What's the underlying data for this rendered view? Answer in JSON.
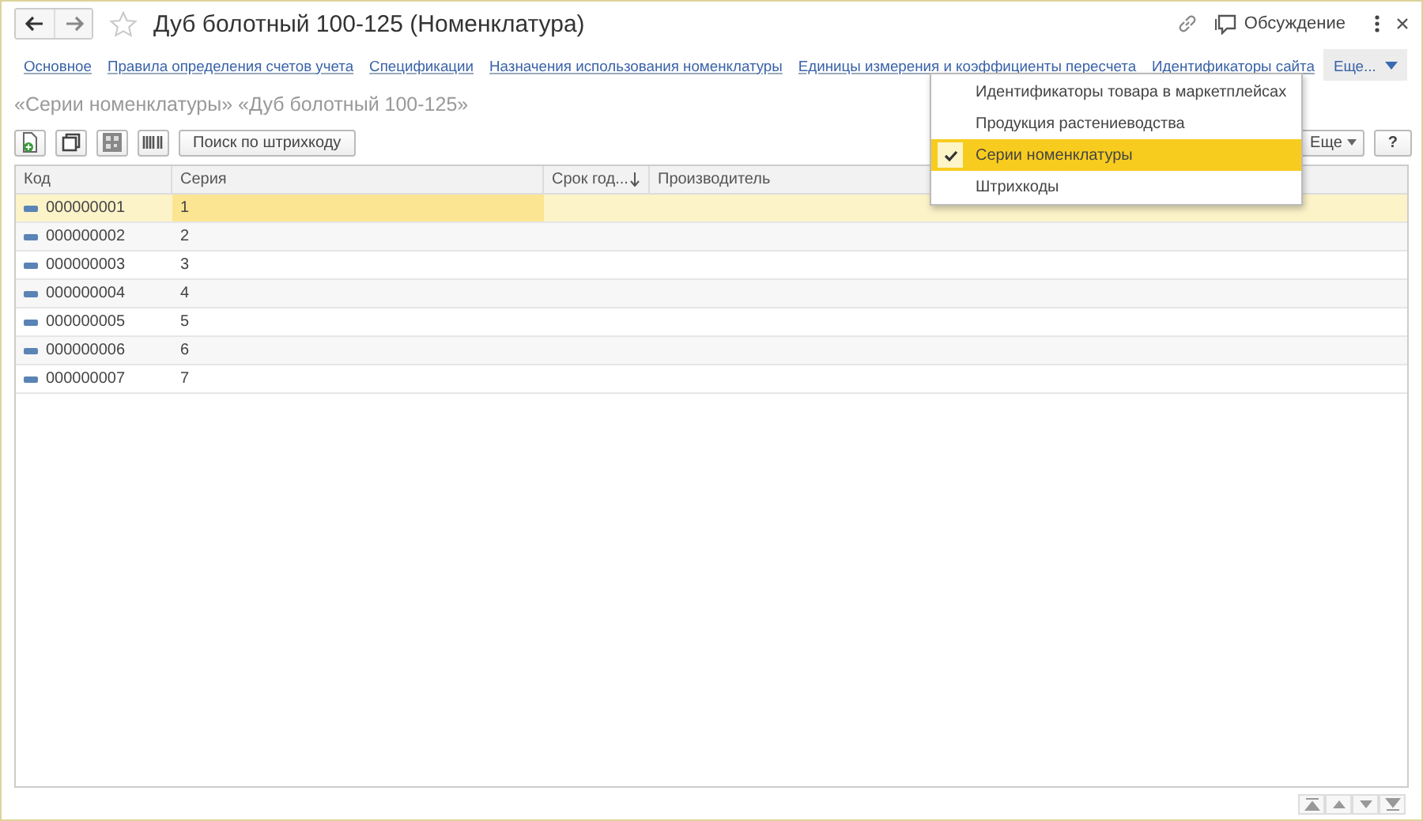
{
  "window": {
    "title": "Дуб болотный 100-125 (Номенклатура)",
    "discussion": "Обсуждение"
  },
  "tabs": [
    {
      "label": "Основное"
    },
    {
      "label": "Правила определения счетов учета"
    },
    {
      "label": "Спецификации"
    },
    {
      "label": "Назначения использования номенклатуры"
    },
    {
      "label": "Единицы измерения и коэффициенты пересчета"
    },
    {
      "label": "Идентификаторы сайта"
    }
  ],
  "more_tab": {
    "label": "Еще...",
    "expanded": true
  },
  "more_menu": [
    {
      "label": "Идентификаторы товара в маркетплейсах",
      "checked": false,
      "selected": false
    },
    {
      "label": "Продукция растениеводства",
      "checked": false,
      "selected": false
    },
    {
      "label": "Серии номенклатуры",
      "checked": true,
      "selected": true
    },
    {
      "label": "Штрихкоды",
      "checked": false,
      "selected": false
    }
  ],
  "subtitle": "«Серии номенклатуры» «Дуб болотный 100-125»",
  "toolbar": {
    "search_button": "Поиск по штрихкоду",
    "more_button": "Еще",
    "help_button": "?"
  },
  "table": {
    "columns": [
      {
        "label": "Код",
        "sorted": false
      },
      {
        "label": "Серия",
        "sorted": false
      },
      {
        "label": "Срок год...",
        "sorted": true
      },
      {
        "label": "Производитель",
        "sorted": false
      }
    ],
    "rows": [
      {
        "code": "000000001",
        "series": "1",
        "selected": true
      },
      {
        "code": "000000002",
        "series": "2",
        "selected": false
      },
      {
        "code": "000000003",
        "series": "3",
        "selected": false
      },
      {
        "code": "000000004",
        "series": "4",
        "selected": false
      },
      {
        "code": "000000005",
        "series": "5",
        "selected": false
      },
      {
        "code": "000000006",
        "series": "6",
        "selected": false
      },
      {
        "code": "000000007",
        "series": "7",
        "selected": false
      }
    ]
  }
}
